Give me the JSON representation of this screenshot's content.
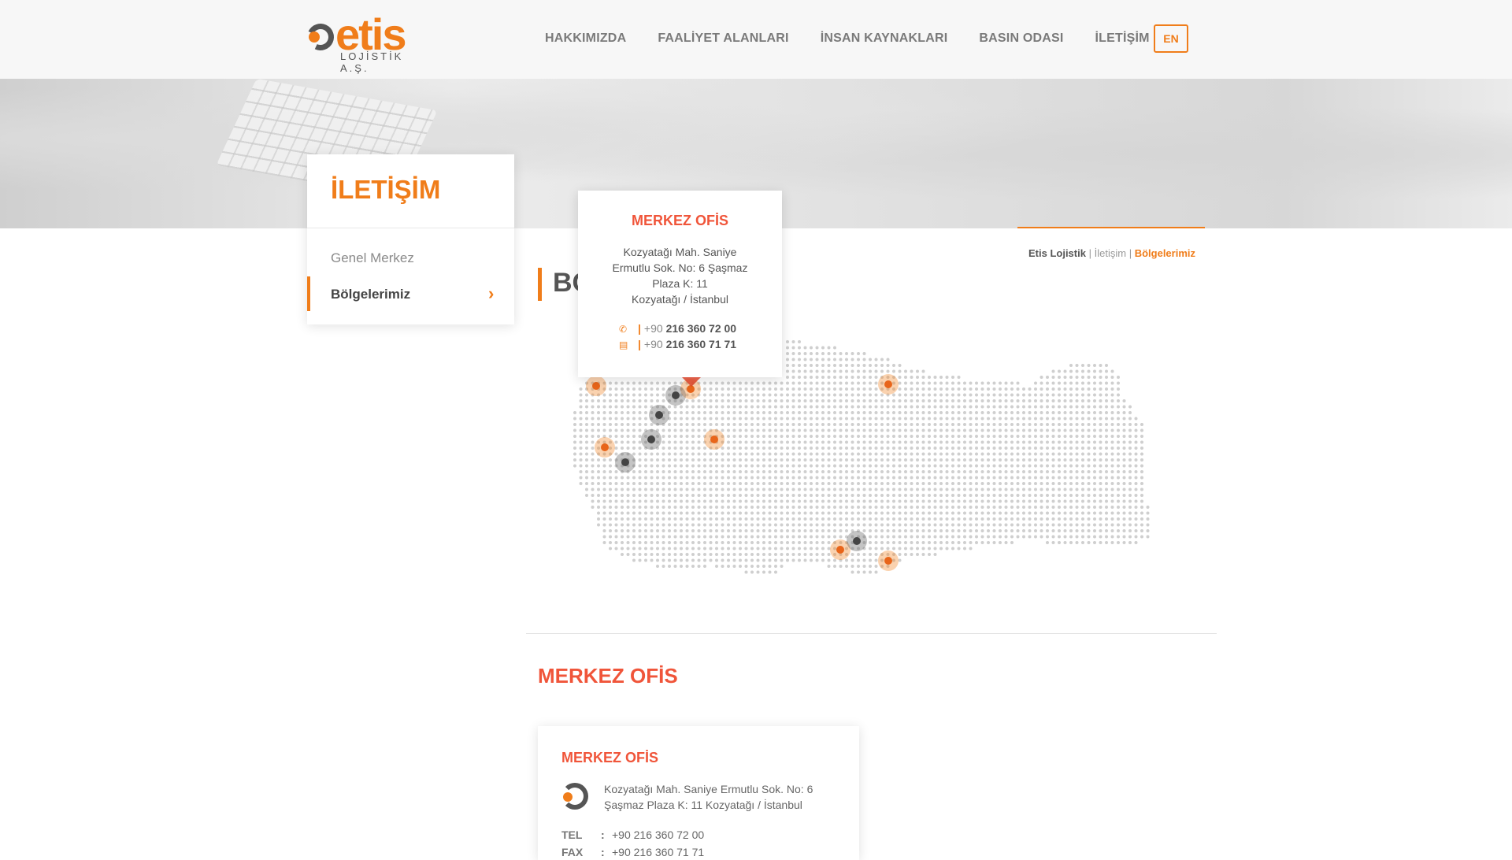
{
  "header": {
    "logo_text": "etis",
    "logo_sub": "LOJİSTİK A.Ş.",
    "nav": [
      "HAKKIMIZDA",
      "FAALİYET ALANLARI",
      "İNSAN KAYNAKLARI",
      "BASIN ODASI",
      "İLETİŞİM"
    ],
    "lang": "EN"
  },
  "sidebar": {
    "title": "İLETİŞİM",
    "items": [
      {
        "label": "Genel Merkez",
        "active": false
      },
      {
        "label": "Bölgelerimiz",
        "active": true
      }
    ]
  },
  "breadcrumb": {
    "home": "Etis Lojistik",
    "sep": "|",
    "parent": "İletişim",
    "current": "Bölgelerimiz"
  },
  "section_heading": "BÖ",
  "popup": {
    "title": "MERKEZ OFİS",
    "address_lines": [
      "Kozyatağı Mah. Saniye",
      "Ermutlu Sok. No: 6 Şaşmaz",
      "Plaza K: 11",
      "Kozyatağı / İstanbul"
    ],
    "phone_prefix": "+90",
    "phone": "216 360 72 00",
    "fax_prefix": "+90",
    "fax": "216 360 71 71",
    "phone_icon": "phone-icon",
    "fax_icon": "fax-icon"
  },
  "office": {
    "section_title": "MERKEZ OFİS",
    "card_title": "MERKEZ OFİS",
    "address": "Kozyatağı Mah. Saniye Ermutlu Sok. No: 6 Şaşmaz Plaza K: 11 Kozyatağı / İstanbul",
    "tel_label": "TEL",
    "tel": "+90 216 360 72 00",
    "fax_label": "FAX",
    "fax": "+90 216 360 71 71"
  },
  "colors": {
    "accent": "#f07d1a",
    "title_red": "#f0553a",
    "marker_orange": "#f07d1a",
    "marker_gray": "#555555"
  }
}
